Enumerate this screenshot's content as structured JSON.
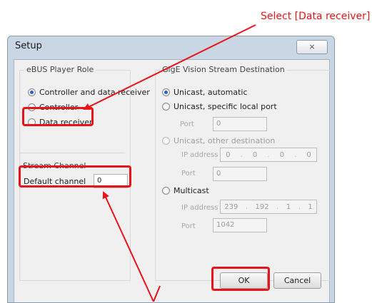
{
  "annotation": {
    "text": "Select [Data receiver]",
    "color": "#e8141a"
  },
  "window": {
    "title": "Setup",
    "close_glyph": "⨯"
  },
  "role": {
    "group_label": "eBUS Player Role",
    "options": [
      {
        "label": "Controller and data receiver",
        "selected": true
      },
      {
        "label": "Controller",
        "selected": false
      },
      {
        "label": "Data receiver",
        "selected": false
      }
    ]
  },
  "stream_channel": {
    "group_label": "Stream Channel",
    "label": "Default channel",
    "value": "0"
  },
  "destination": {
    "group_label": "GigE Vision Stream Destination",
    "options": [
      {
        "label": "Unicast, automatic",
        "selected": true
      },
      {
        "label": "Unicast, specific local port",
        "selected": false
      },
      {
        "label": "Unicast, other destination",
        "selected": false,
        "disabled": true
      },
      {
        "label": "Multicast",
        "selected": false
      }
    ],
    "local_port": {
      "label": "Port",
      "value": "0"
    },
    "other": {
      "ip_label": "IP address",
      "ip": [
        "0",
        "0",
        "0",
        "0"
      ],
      "port_label": "Port",
      "port_value": "0"
    },
    "multicast": {
      "ip_label": "IP address",
      "ip": [
        "239",
        "192",
        "1",
        "1"
      ],
      "port_label": "Port",
      "port_value": "1042"
    }
  },
  "buttons": {
    "ok": "OK",
    "cancel": "Cancel"
  }
}
